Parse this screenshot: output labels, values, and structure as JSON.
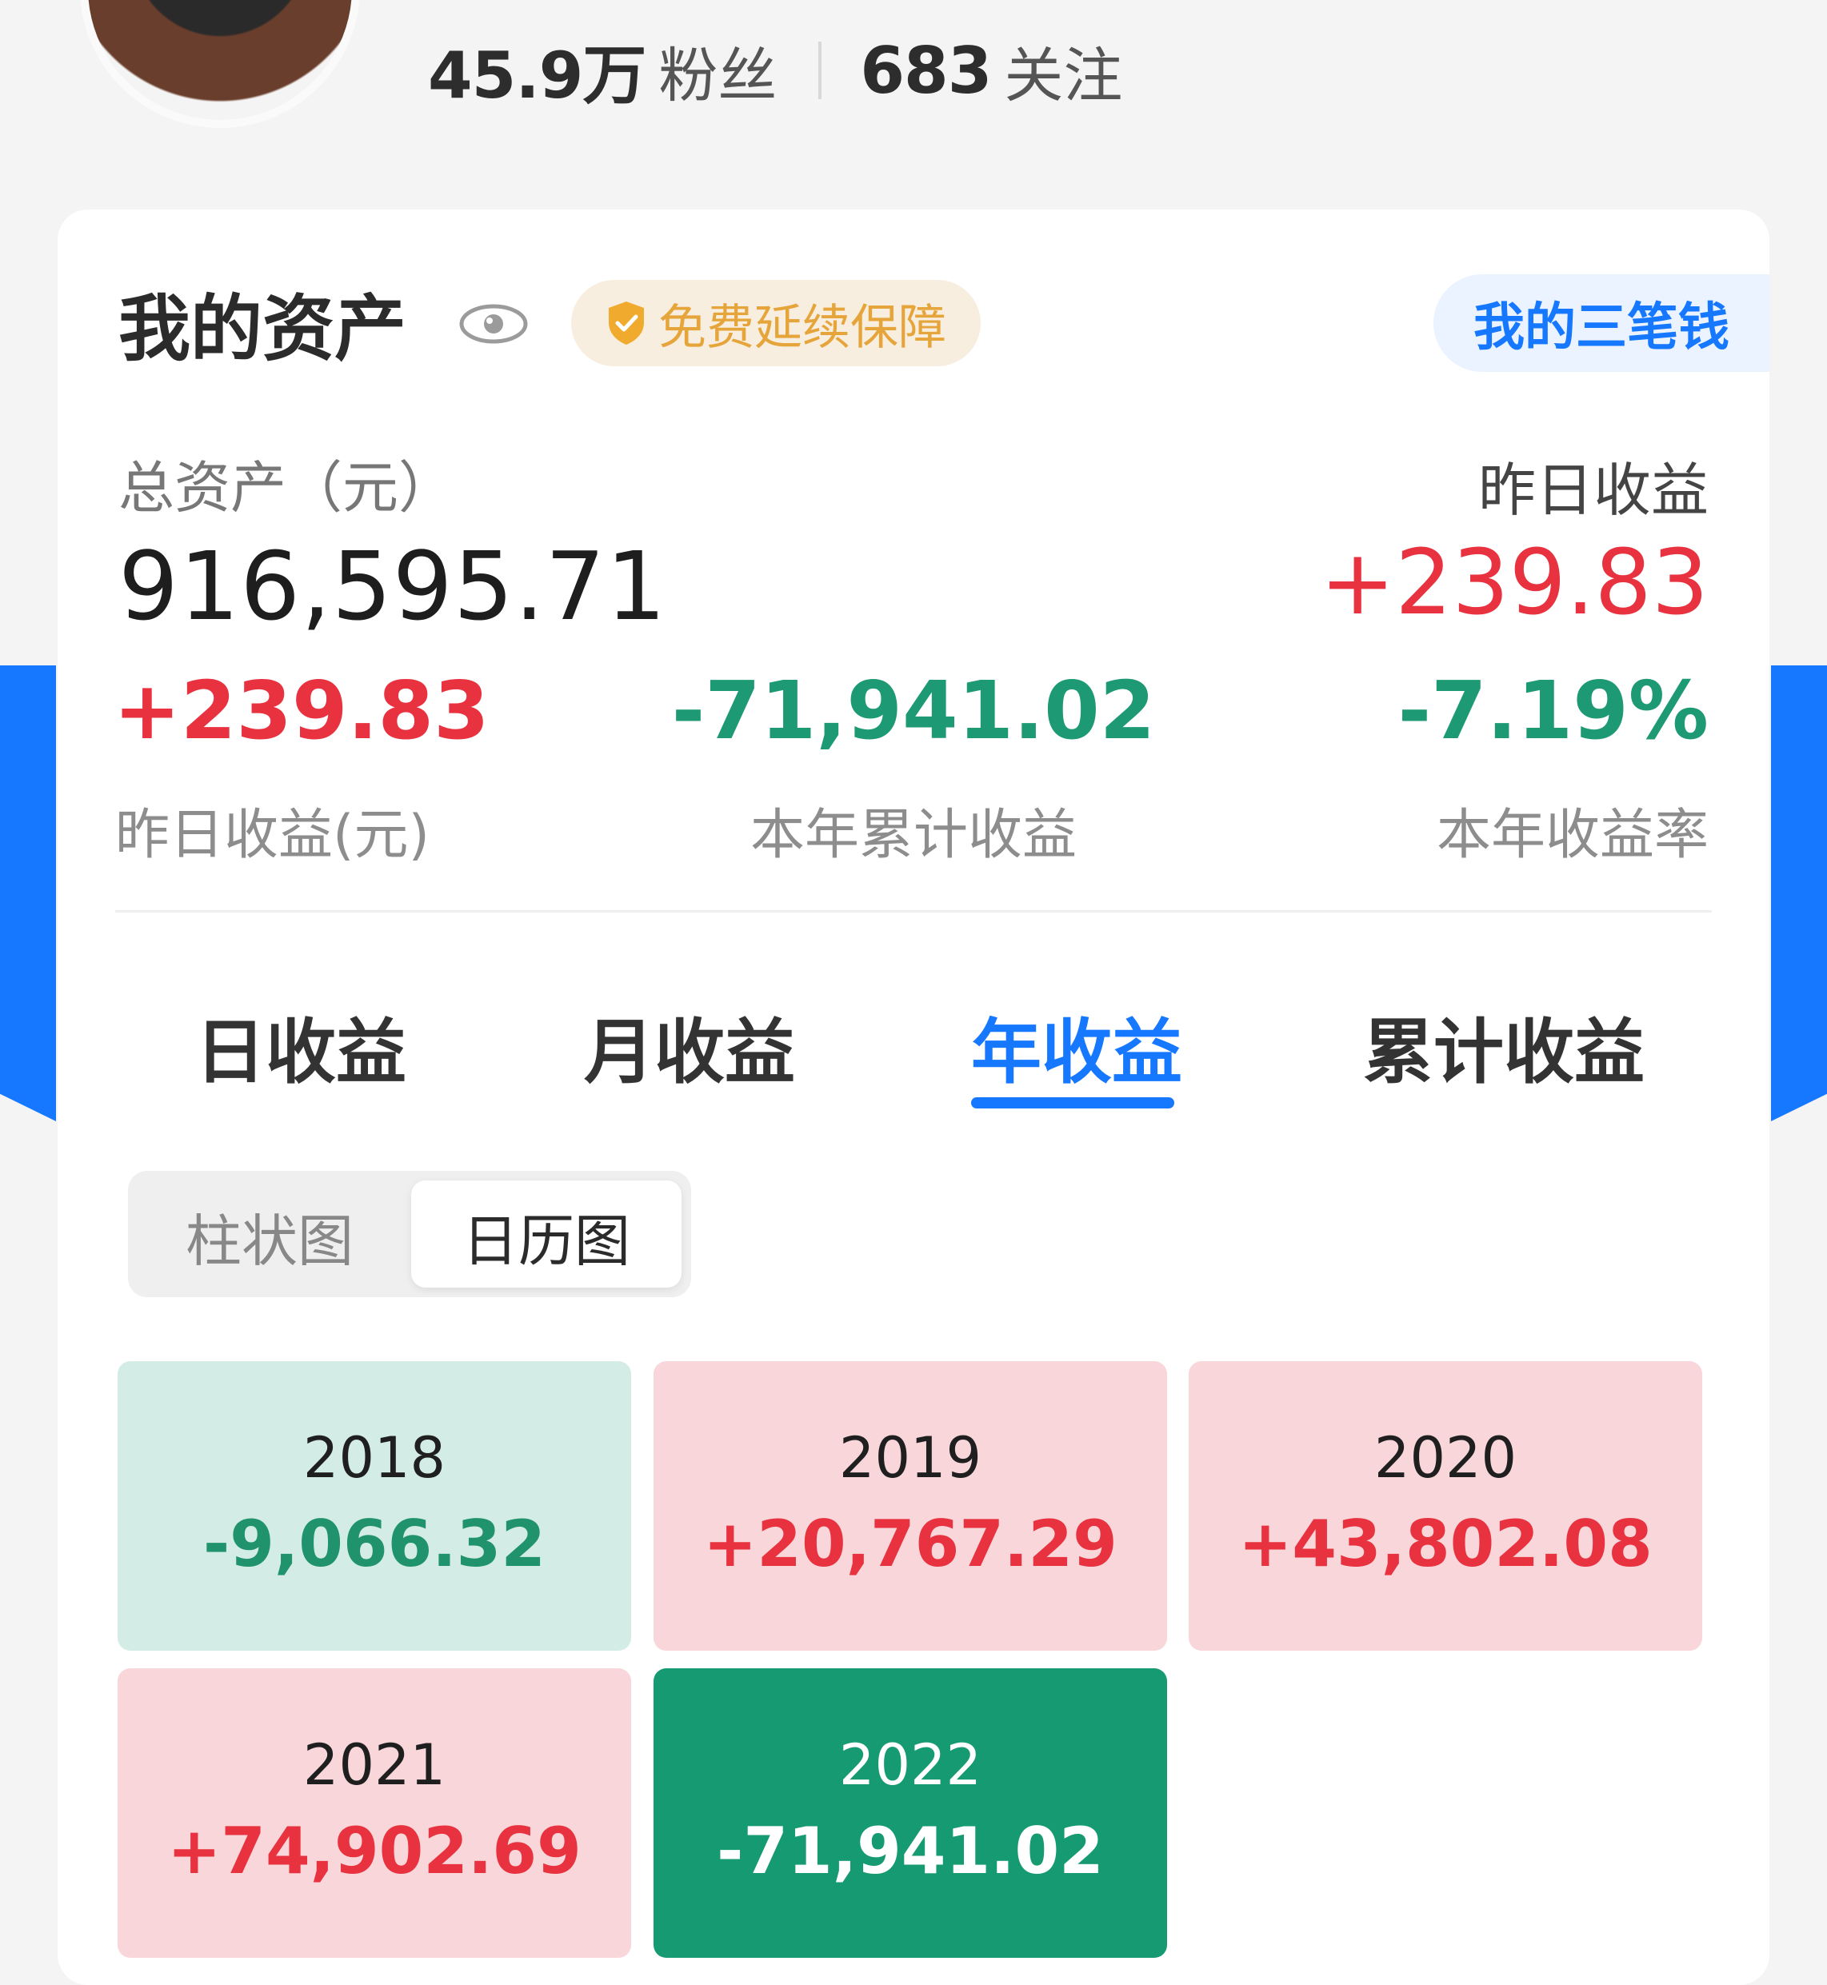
{
  "profile": {
    "followers_value": "45.9万",
    "followers_label": "粉丝",
    "following_value": "683",
    "following_label": "关注"
  },
  "assets": {
    "title": "我的资产",
    "badge_text": "免费延续保障",
    "three_money_button": "我的三笔钱",
    "total_label": "总资产（元）",
    "total_value": "916,595.71",
    "yesterday_label": "昨日收益",
    "yesterday_value": "+239.83"
  },
  "metrics": [
    {
      "value": "+239.83",
      "label": "昨日收益(元)"
    },
    {
      "value": "-71,941.02",
      "label": "本年累计收益"
    },
    {
      "value": "-7.19%",
      "label": "本年收益率"
    }
  ],
  "tabs": [
    "日收益",
    "月收益",
    "年收益",
    "累计收益"
  ],
  "active_tab": "年收益",
  "view_toggle": {
    "options": [
      "柱状图",
      "日历图"
    ],
    "selected": "日历图"
  },
  "colors": {
    "accent": "#1677ff",
    "gain": "#e8323f",
    "loss": "#1d9a73",
    "badge": "#e6a53a"
  },
  "years": [
    {
      "year": "2018",
      "pnl": "-9,066.32"
    },
    {
      "year": "2019",
      "pnl": "+20,767.29"
    },
    {
      "year": "2020",
      "pnl": "+43,802.08"
    },
    {
      "year": "2021",
      "pnl": "+74,902.69"
    },
    {
      "year": "2022",
      "pnl": "-71,941.02"
    }
  ]
}
